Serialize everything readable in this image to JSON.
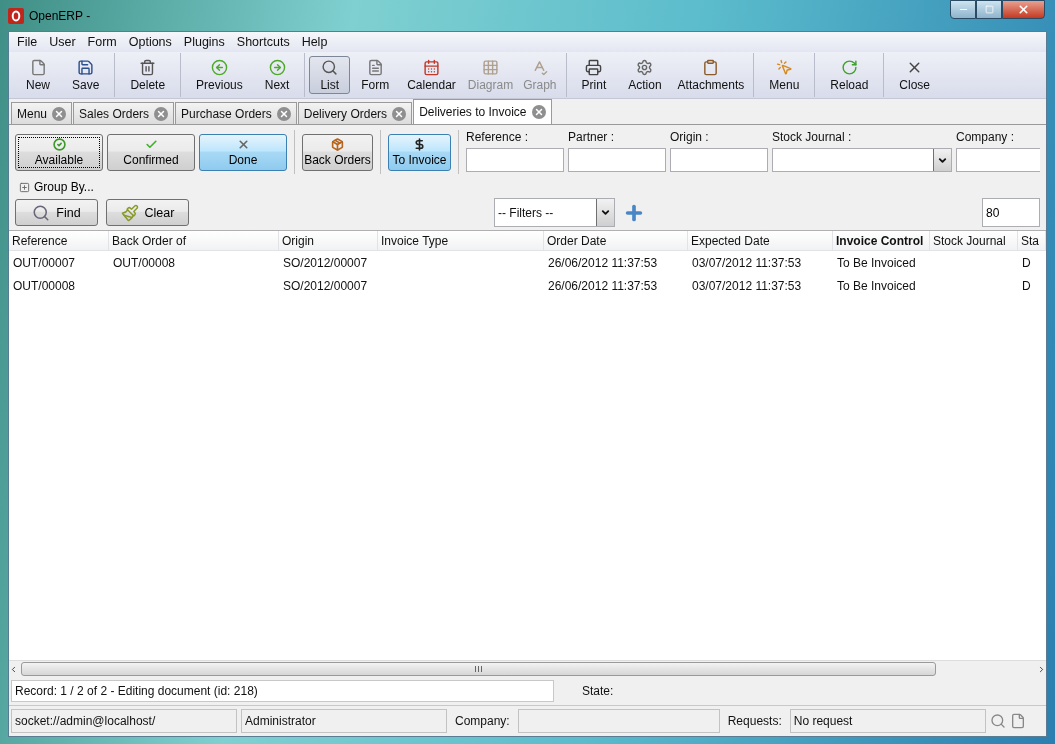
{
  "window": {
    "title": "OpenERP -"
  },
  "menu": [
    "File",
    "User",
    "Form",
    "Options",
    "Plugins",
    "Shortcuts",
    "Help"
  ],
  "toolbar_groups": [
    {
      "items": [
        {
          "label": "New",
          "selected": false,
          "disabled": false
        },
        {
          "label": "Save",
          "selected": false,
          "disabled": false
        }
      ]
    },
    {
      "items": [
        {
          "label": "Delete",
          "selected": false,
          "disabled": false
        }
      ]
    },
    {
      "items": [
        {
          "label": "Previous",
          "selected": false,
          "disabled": false
        },
        {
          "label": "Next",
          "selected": false,
          "disabled": false
        }
      ]
    },
    {
      "items": [
        {
          "label": "List",
          "selected": true,
          "disabled": false
        },
        {
          "label": "Form",
          "selected": false,
          "disabled": false
        },
        {
          "label": "Calendar",
          "selected": false,
          "disabled": false
        },
        {
          "label": "Diagram",
          "selected": false,
          "disabled": true
        },
        {
          "label": "Graph",
          "selected": false,
          "disabled": true
        }
      ]
    },
    {
      "items": [
        {
          "label": "Print",
          "selected": false,
          "disabled": false
        },
        {
          "label": "Action",
          "selected": false,
          "disabled": false
        },
        {
          "label": "Attachments",
          "selected": false,
          "disabled": false
        }
      ]
    },
    {
      "items": [
        {
          "label": "Menu",
          "selected": false,
          "disabled": false
        }
      ]
    },
    {
      "items": [
        {
          "label": "Reload",
          "selected": false,
          "disabled": false
        }
      ]
    },
    {
      "items": [
        {
          "label": "Close",
          "selected": false,
          "disabled": false
        }
      ]
    }
  ],
  "tabs": [
    {
      "label": "Menu",
      "selected": false
    },
    {
      "label": "Sales Orders",
      "selected": false
    },
    {
      "label": "Purchase Orders",
      "selected": false
    },
    {
      "label": "Delivery Orders",
      "selected": false
    },
    {
      "label": "Deliveries to Invoice",
      "selected": true
    }
  ],
  "filter_groups": [
    {
      "buttons": [
        {
          "label": "Available",
          "selected": false,
          "focused": true
        },
        {
          "label": "Confirmed",
          "selected": false,
          "focused": false
        },
        {
          "label": "Done",
          "selected": true,
          "focused": false
        }
      ]
    },
    {
      "buttons": [
        {
          "label": "Back Orders",
          "selected": false,
          "focused": false
        }
      ]
    },
    {
      "buttons": [
        {
          "label": "To Invoice",
          "selected": true,
          "focused": false
        }
      ]
    }
  ],
  "search_fields": [
    {
      "label": "Reference :",
      "kind": "text"
    },
    {
      "label": "Partner :",
      "kind": "text"
    },
    {
      "label": "Origin :",
      "kind": "text"
    },
    {
      "label": "Stock Journal :",
      "kind": "select"
    },
    {
      "label": "Company :",
      "kind": "text"
    }
  ],
  "group_by": {
    "label": "Group By...",
    "expanded": false
  },
  "actions": [
    "Find",
    "Clear"
  ],
  "filters_select": {
    "value": "-- Filters --"
  },
  "limit": {
    "value": "80"
  },
  "table": {
    "columns": [
      {
        "label": "Reference",
        "sorted": false
      },
      {
        "label": "Back Order of",
        "sorted": false
      },
      {
        "label": "Origin",
        "sorted": false
      },
      {
        "label": "Invoice Type",
        "sorted": false
      },
      {
        "label": "Order Date",
        "sorted": false
      },
      {
        "label": "Expected Date",
        "sorted": false
      },
      {
        "label": "Invoice Control",
        "sorted": true
      },
      {
        "label": "Stock Journal",
        "sorted": false
      },
      {
        "label": "Sta",
        "sorted": false
      }
    ],
    "rows": [
      [
        "OUT/00007",
        "OUT/00008",
        "SO/2012/00007",
        "",
        "26/06/2012 11:37:53",
        "03/07/2012 11:37:53",
        "To Be Invoiced",
        "",
        "D"
      ],
      [
        "OUT/00008",
        "",
        "SO/2012/00007",
        "",
        "26/06/2012 11:37:53",
        "03/07/2012 11:37:53",
        "To Be Invoiced",
        "",
        "D"
      ]
    ]
  },
  "record_line": {
    "text": "Record: 1 / 2 of 2 - Editing document (id: 218)",
    "state_label": "State:"
  },
  "status_bar": {
    "connection": "socket://admin@localhost/",
    "user": "Administrator",
    "company_label": "Company:",
    "requests_label": "Requests:",
    "requests": "No request"
  }
}
